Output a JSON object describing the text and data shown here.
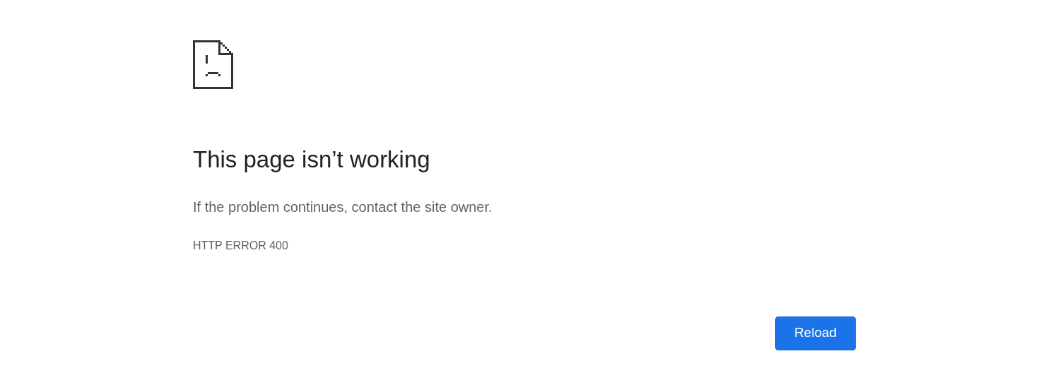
{
  "heading": "This page isn’t working",
  "message": "If the problem continues, contact the site owner.",
  "error_code": "HTTP ERROR 400",
  "buttons": [
    {
      "label": "Reload"
    }
  ]
}
